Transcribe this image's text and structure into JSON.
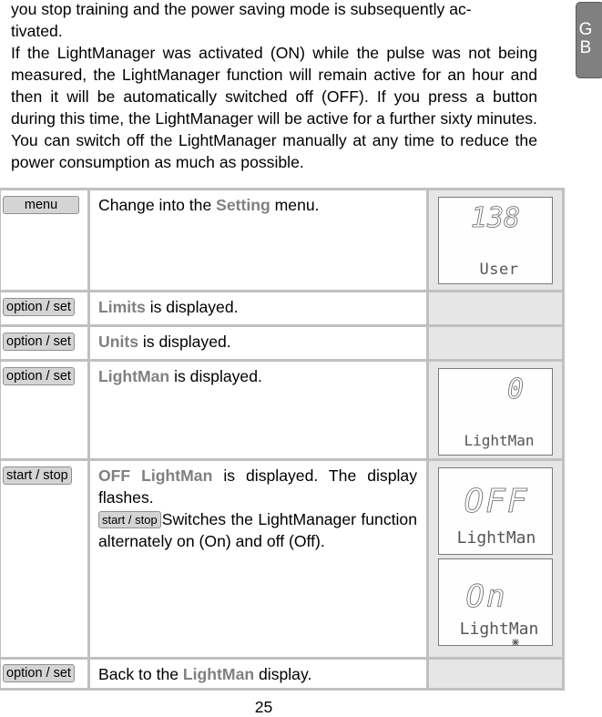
{
  "intro": {
    "paragraphs": [
      "you stop training and the power saving mode is subsequently activated.",
      "If the LightManager was activated (ON) while the pulse was not being measured, the LightManager function will remain active for an hour and then it will be automatically switched off (OFF). If you press a button during this time, the LightManager will be active for a further sixty minutes.",
      "You can switch off the LightManager manually at any time to reduce the power consumption as much as possible."
    ],
    "p1a": "you stop training and the power saving mode is subsequently ac-",
    "p1b": "tivated."
  },
  "language_tab": {
    "line1": "G",
    "line2": "B"
  },
  "steps": [
    {
      "key": "menu",
      "text_pre": "Change into the ",
      "highlight": "Setting",
      "text_post": " menu.",
      "display": {
        "digits": "138",
        "label": "User"
      }
    },
    {
      "key": "option / set",
      "text_pre": "",
      "highlight": "Limits",
      "text_post": " is displayed.",
      "display": null
    },
    {
      "key": "option / set",
      "text_pre": "",
      "highlight": "Units",
      "text_post": " is displayed.",
      "display": null
    },
    {
      "key": "option / set",
      "text_pre": "",
      "highlight": "LightMan",
      "text_post": " is displayed.",
      "display": {
        "digits": "0",
        "label": "LightMan"
      }
    },
    {
      "key": "start / stop",
      "text_pre": "",
      "highlight": "OFF LightMan",
      "text_post": " is displayed. The display flashes.",
      "inline_key": "start / stop",
      "text_after_inline": "Switches the LightManager function alternately on (On) and off (Off).",
      "displays": [
        {
          "digits": "OFF",
          "label": "LightMan"
        },
        {
          "digits": "On",
          "label": "LightMan",
          "icon": "light-icon"
        }
      ]
    },
    {
      "key": "option / set",
      "text_pre": "Back to the ",
      "highlight": "LightMan",
      "text_post": " display.",
      "display": null
    }
  ],
  "page_number": "25",
  "colors": {
    "highlight": "#808080",
    "table_border": "#c0c0c0",
    "display_cell": "#e6e6e6",
    "tab": "#808080"
  }
}
